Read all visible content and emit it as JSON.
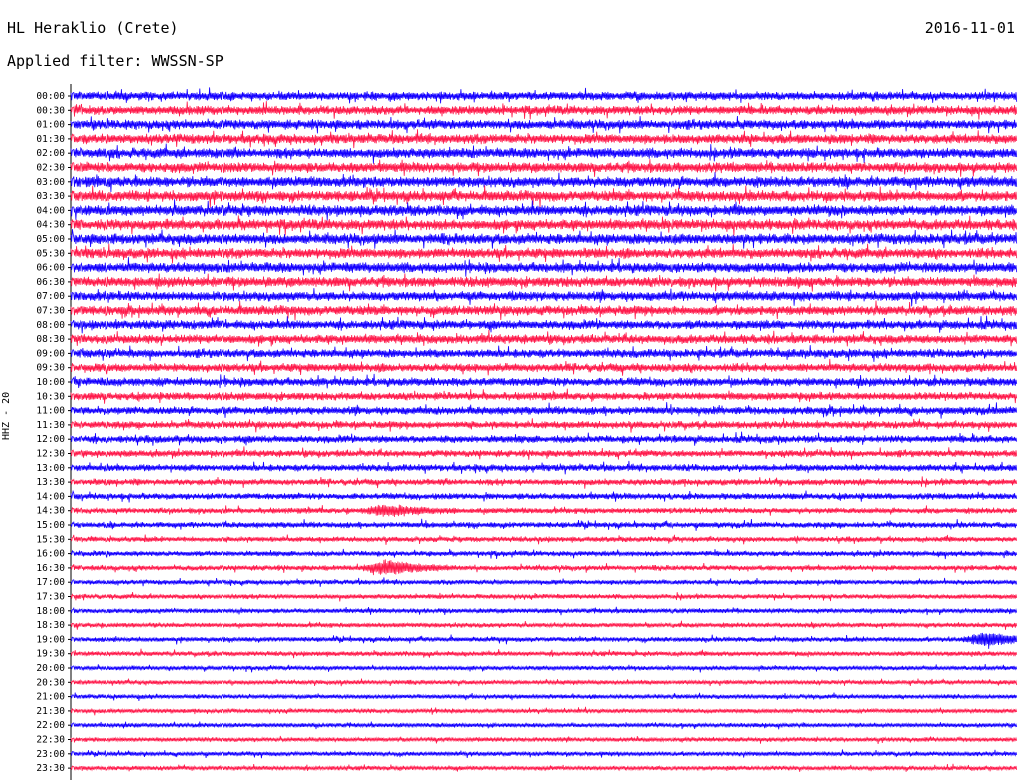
{
  "header": {
    "station": "HL Heraklio (Crete)",
    "date": "2016-11-01",
    "filter": "Applied filter: WWSSN-SP"
  },
  "chart_data": {
    "type": "line",
    "title": "HL Heraklio (Crete)",
    "ylabel": "HHZ - 20",
    "tick_labels": [
      "00:00",
      "00:30",
      "01:00",
      "01:30",
      "02:00",
      "02:30",
      "03:00",
      "03:30",
      "04:00",
      "04:30",
      "05:00",
      "05:30",
      "06:00",
      "06:30",
      "07:00",
      "07:30",
      "08:00",
      "08:30",
      "09:00",
      "09:30",
      "10:00",
      "10:30",
      "11:00",
      "11:30",
      "12:00",
      "12:30",
      "13:00",
      "13:30",
      "14:00",
      "14:30",
      "15:00",
      "15:30",
      "16:00",
      "16:30",
      "17:00",
      "17:30",
      "18:00",
      "18:30",
      "19:00",
      "19:30",
      "20:00",
      "20:30",
      "21:00",
      "21:30",
      "22:00",
      "22:30",
      "23:00",
      "23:30"
    ],
    "trace_colors": [
      "#1400ff",
      "#ff1a4b"
    ],
    "row_amplitude_level": [
      0.8,
      0.85,
      0.9,
      0.9,
      0.95,
      0.95,
      1.0,
      1.0,
      1.0,
      1.0,
      1.0,
      0.95,
      0.95,
      0.95,
      0.9,
      0.9,
      0.85,
      0.85,
      0.8,
      0.8,
      0.8,
      0.75,
      0.75,
      0.7,
      0.7,
      0.65,
      0.65,
      0.6,
      0.6,
      0.55,
      0.55,
      0.5,
      0.5,
      0.5,
      0.45,
      0.45,
      0.45,
      0.45,
      0.45,
      0.45,
      0.4,
      0.4,
      0.4,
      0.4,
      0.4,
      0.4,
      0.4,
      0.4
    ],
    "events": [
      {
        "row": "16:30",
        "minute": 10,
        "strength": 2.0
      },
      {
        "row": "19:00",
        "minute": 29,
        "strength": 2.2
      },
      {
        "row": "14:30",
        "minute": 10,
        "strength": 1.4
      }
    ]
  }
}
